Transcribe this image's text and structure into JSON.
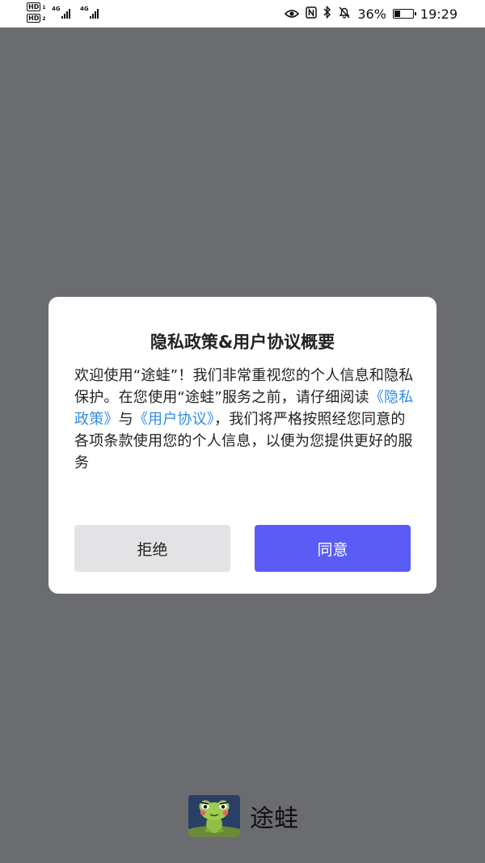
{
  "status_bar": {
    "sim1_label": "HD",
    "sim2_label": "HD",
    "sim1_index": "1",
    "sim2_index": "2",
    "network1": "4G",
    "network2": "4G",
    "battery_percent": "36%",
    "battery_level": 0.36,
    "time": "19:29",
    "icons": [
      "eye-icon",
      "nfc-icon",
      "bluetooth-icon",
      "mute-bell-icon",
      "battery-icon"
    ]
  },
  "dialog": {
    "title": "隐私政策&用户协议概要",
    "body_part1": "欢迎使用“途蛙”！我们非常重视您的个人信息和隐私保护。在您使用“途蛙”服务之前，请仔细阅读",
    "privacy_link": "《隐私政策》",
    "conjunction": "与",
    "agreement_link": "《用户协议》",
    "body_part2": "，我们将严格按照经您同意的各项条款使用您的个人信息，以便为您提供更好的服务",
    "reject_label": "拒绝",
    "agree_label": "同意"
  },
  "brand": {
    "app_name": "途蛙",
    "logo_icon": "frog-logo-icon"
  },
  "colors": {
    "overlay": "#6b6c6f",
    "link": "#2f8ce6",
    "agree_button": "#5a5cf5",
    "reject_button": "#e3e3e6"
  }
}
